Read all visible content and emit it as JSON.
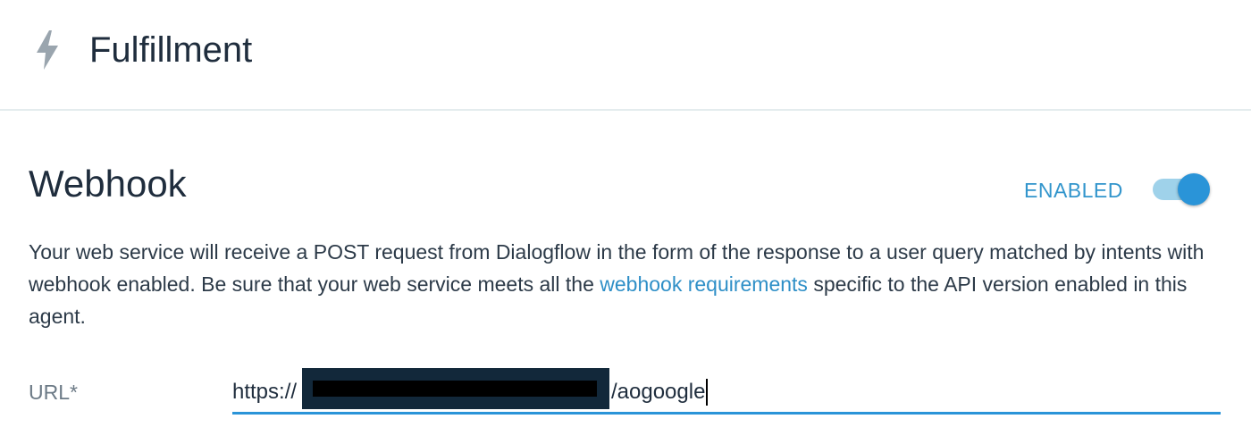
{
  "header": {
    "title": "Fulfillment",
    "icon": "lightning-bolt-icon"
  },
  "webhook": {
    "title": "Webhook",
    "status_label": "ENABLED",
    "toggle_on": true,
    "accent_color": "#2a94d8",
    "description_before": "Your web service will receive a POST request from Dialogflow in the form of the response to a user query matched by intents with webhook enabled. Be sure that your web service meets all the ",
    "description_link": "webhook requirements",
    "description_after": " specific to the API version enabled in this agent."
  },
  "url_field": {
    "label": "URL*",
    "prefix": "https://",
    "suffix": "/aogoogle"
  }
}
